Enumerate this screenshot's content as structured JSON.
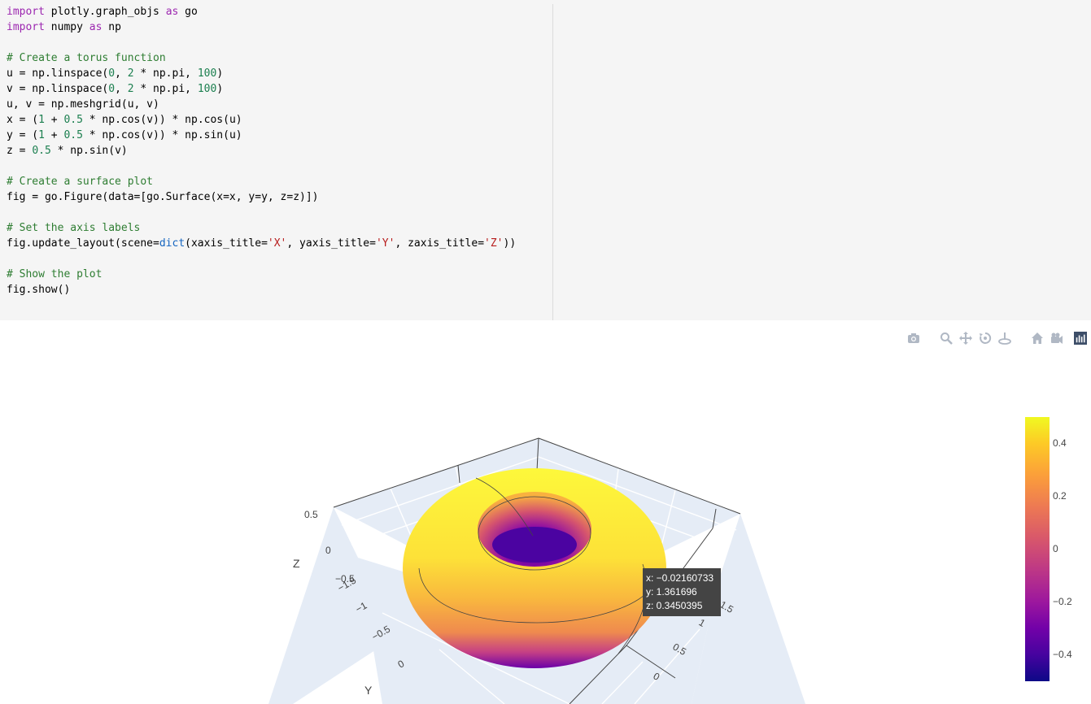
{
  "code_lines": [
    [
      {
        "t": "import",
        "c": "kw"
      },
      {
        "t": " plotly.graph_objs "
      },
      {
        "t": "as",
        "c": "kw"
      },
      {
        "t": " go"
      }
    ],
    [
      {
        "t": "import",
        "c": "kw"
      },
      {
        "t": " numpy "
      },
      {
        "t": "as",
        "c": "kw"
      },
      {
        "t": " np"
      }
    ],
    [],
    [
      {
        "t": "# Create a torus function",
        "c": "cm"
      }
    ],
    [
      {
        "t": "u = np.linspace("
      },
      {
        "t": "0",
        "c": "num"
      },
      {
        "t": ", "
      },
      {
        "t": "2",
        "c": "num"
      },
      {
        "t": " * np.pi, "
      },
      {
        "t": "100",
        "c": "num"
      },
      {
        "t": ")"
      }
    ],
    [
      {
        "t": "v = np.linspace("
      },
      {
        "t": "0",
        "c": "num"
      },
      {
        "t": ", "
      },
      {
        "t": "2",
        "c": "num"
      },
      {
        "t": " * np.pi, "
      },
      {
        "t": "100",
        "c": "num"
      },
      {
        "t": ")"
      }
    ],
    [
      {
        "t": "u, v = np.meshgrid(u, v)"
      }
    ],
    [
      {
        "t": "x = ("
      },
      {
        "t": "1",
        "c": "num"
      },
      {
        "t": " + "
      },
      {
        "t": "0.5",
        "c": "num"
      },
      {
        "t": " * np.cos(v)) * np.cos(u)"
      }
    ],
    [
      {
        "t": "y = ("
      },
      {
        "t": "1",
        "c": "num"
      },
      {
        "t": " + "
      },
      {
        "t": "0.5",
        "c": "num"
      },
      {
        "t": " * np.cos(v)) * np.sin(u)"
      }
    ],
    [
      {
        "t": "z = "
      },
      {
        "t": "0.5",
        "c": "num"
      },
      {
        "t": " * np.sin(v)"
      }
    ],
    [],
    [
      {
        "t": "# Create a surface plot",
        "c": "cm"
      }
    ],
    [
      {
        "t": "fig = go.Figure(data=[go.Surface(x=x, y=y, z=z)])"
      }
    ],
    [],
    [
      {
        "t": "# Set the axis labels",
        "c": "cm"
      }
    ],
    [
      {
        "t": "fig.update_layout(scene="
      },
      {
        "t": "dict",
        "c": "bi"
      },
      {
        "t": "(xaxis_title="
      },
      {
        "t": "'X'",
        "c": "str"
      },
      {
        "t": ", yaxis_title="
      },
      {
        "t": "'Y'",
        "c": "str"
      },
      {
        "t": ", zaxis_title="
      },
      {
        "t": "'Z'",
        "c": "str"
      },
      {
        "t": "))"
      }
    ],
    [],
    [
      {
        "t": "# Show the plot",
        "c": "cm"
      }
    ],
    [
      {
        "t": "fig.show()"
      }
    ]
  ],
  "modebar": {
    "icons": [
      "camera-icon",
      "zoom-icon",
      "pan-icon",
      "orbit-rotation-icon",
      "turntable-rotation-icon",
      "reset-camera-icon",
      "camera-view-icon",
      "plotly-logo-icon"
    ]
  },
  "plot": {
    "z_axis_title": "Z",
    "y_axis_title": "Y",
    "z_ticks": [
      "0.5",
      "0",
      "−0.5"
    ],
    "y_ticks": [
      "−1.5",
      "−1",
      "−0.5",
      "0"
    ],
    "x_ticks": [
      "1.5",
      "1",
      "0.5",
      "0"
    ],
    "colorscale": "plasma",
    "colorbar_ticks": [
      "0.4",
      "0.2",
      "0",
      "−0.2",
      "−0.4"
    ]
  },
  "tooltip": {
    "x": "x: −0.02160733",
    "y": "y: 1.361696",
    "z": "z: 0.3450395"
  },
  "chart_data": {
    "type": "surface",
    "surface": "torus",
    "equations": {
      "x": "(1 + 0.5*cos(v)) * cos(u)",
      "y": "(1 + 0.5*cos(v)) * sin(u)",
      "z": "0.5*sin(v)"
    },
    "u_range": [
      0,
      6.2832
    ],
    "v_range": [
      0,
      6.2832
    ],
    "z_range": [
      -0.5,
      0.5
    ],
    "colorbar_range": [
      -0.5,
      0.5
    ],
    "hover_point": {
      "x": -0.02160733,
      "y": 1.361696,
      "z": 0.3450395
    }
  }
}
